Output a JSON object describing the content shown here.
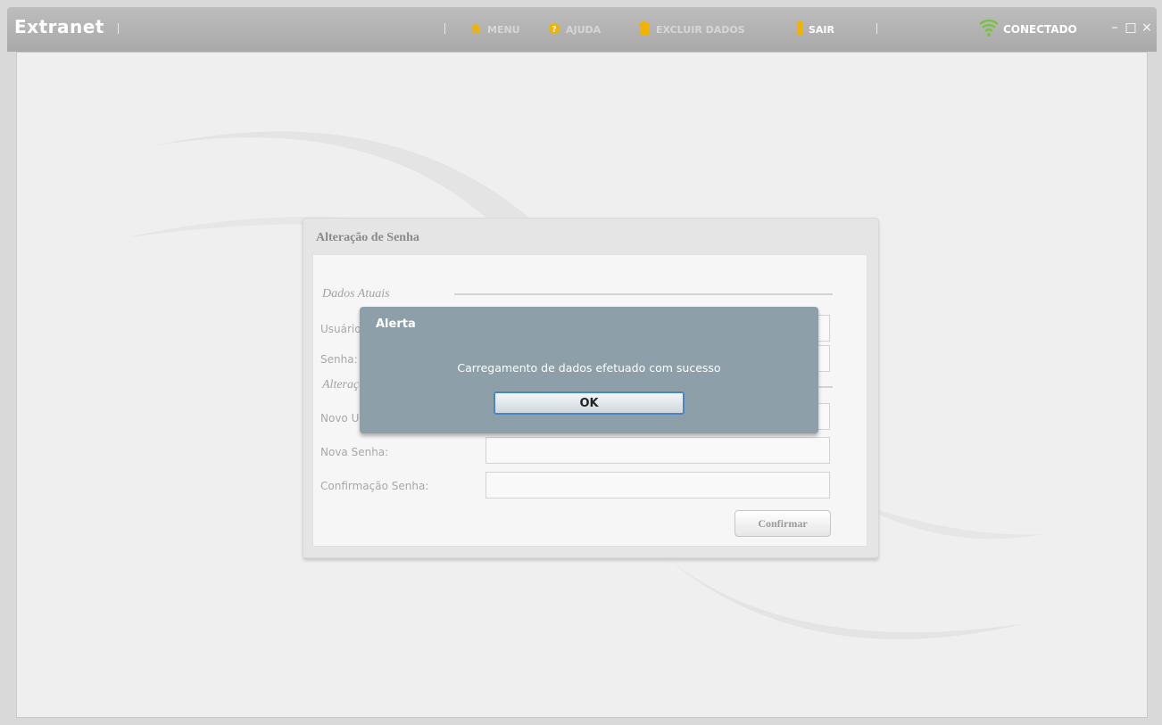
{
  "app": {
    "title": "Extranet"
  },
  "menu": {
    "items": [
      {
        "label": "MENU",
        "icon": "home-icon"
      },
      {
        "label": "AJUDA",
        "icon": "help-icon"
      },
      {
        "label": "EXCLUIR DADOS",
        "icon": "trash-icon"
      },
      {
        "label": "SAIR",
        "icon": "exit-icon"
      }
    ]
  },
  "status": {
    "label": "CONECTADO",
    "icon": "wifi-signal-icon"
  },
  "window_controls": {
    "minimize": "–",
    "maximize": "□",
    "close": "×"
  },
  "panel": {
    "title": "Alteração de Senha",
    "section_current": "Dados Atuais",
    "section_change": "Alteração",
    "fields": {
      "usuario_label": "Usuário:",
      "senha_label": "Senha:",
      "novo_usuario_label": "Novo Usuário:",
      "nova_senha_label": "Nova Senha:",
      "confirmacao_label": "Confirmação Senha:"
    },
    "confirm_button": "Confirmar"
  },
  "alert": {
    "title": "Alerta",
    "message": "Carregamento de dados efetuado com sucesso",
    "ok_button": "OK"
  },
  "colors": {
    "titlebar": "#b3b3b3",
    "alert_bg": "#8d9fa8",
    "ok_border": "#4a86c5",
    "connected_green": "#7ac143"
  }
}
